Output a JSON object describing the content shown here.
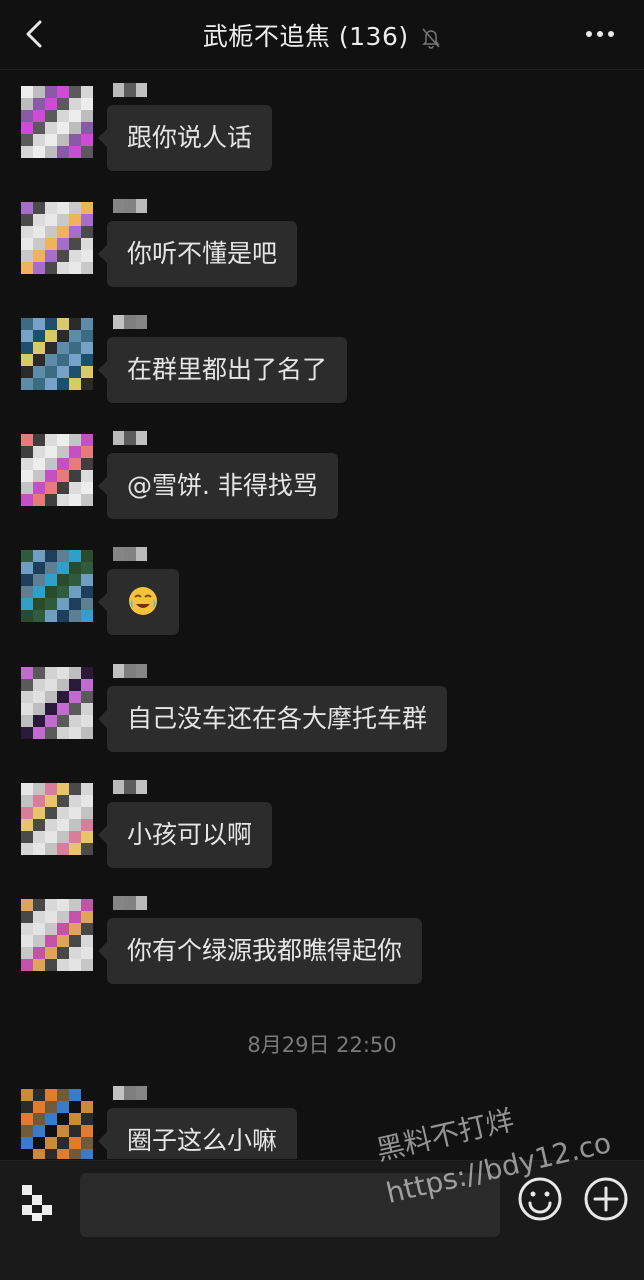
{
  "header": {
    "title": "武栀不追焦",
    "member_count": "(136)",
    "back_icon": "chevron-left-icon",
    "mute_icon": "bell-muted-icon",
    "more_icon": "more-dots-icon"
  },
  "messages": [
    {
      "text": "跟你说人话",
      "avatar_colors": [
        "#ededed",
        "#bdbdbd",
        "#8a5aa8",
        "#cf4ad6",
        "#5a5a5a",
        "#d6d6d6"
      ]
    },
    {
      "text": "你听不懂是吧",
      "avatar_colors": [
        "#e8e8e8",
        "#c9c9c9",
        "#f0b35a",
        "#a56fc9",
        "#4a4a4a",
        "#dcdcdc"
      ]
    },
    {
      "text": "在群里都出了名了",
      "avatar_colors": [
        "#3b6c84",
        "#77a2c7",
        "#1f4f6e",
        "#d9c96a",
        "#2a2a2a",
        "#5d8ca8"
      ]
    },
    {
      "text": "@雪饼. 非得找骂",
      "avatar_colors": [
        "#ededed",
        "#c5c5c5",
        "#c64fc4",
        "#e57b7b",
        "#3f3f3f",
        "#dcdcdc"
      ]
    },
    {
      "text": "",
      "emoji": "face-with-tears-of-joy-emoji",
      "avatar_colors": [
        "#2f5c3f",
        "#6f9ec2",
        "#1d3f5c",
        "#5e7f93",
        "#30a0c9",
        "#2c4a2c"
      ]
    },
    {
      "text": "自己没车还在各大摩托车群",
      "avatar_colors": [
        "#e0e0e0",
        "#bdbdbd",
        "#2a1a3a",
        "#c36ad0",
        "#5a5a5a",
        "#d2d2d2"
      ]
    },
    {
      "text": "小孩可以啊",
      "avatar_colors": [
        "#e6e6e6",
        "#c2c2c2",
        "#d97e9a",
        "#e8c46a",
        "#4a4a4a",
        "#d6d6d6"
      ]
    },
    {
      "text": "你有个绿源我都瞧得起你",
      "avatar_colors": [
        "#e4e4e4",
        "#c7c7c7",
        "#c651a8",
        "#e0a35a",
        "#474747",
        "#d8d8d8"
      ]
    },
    {
      "text": "圈子这么小嘛",
      "avatar_colors": [
        "#c98a3a",
        "#2b2b2b",
        "#e07b2f",
        "#6f5a3a",
        "#3a7ac9",
        "#111111"
      ]
    }
  ],
  "timestamp": "8月29日 22:50",
  "inputbar": {
    "voice_icon": "voice-keyboard-icon",
    "input_value": "",
    "emoji_icon": "smiley-icon",
    "plus_icon": "plus-circle-icon"
  },
  "watermark": {
    "line1": "黑料不打烊",
    "line2": "https://bdy12.co"
  },
  "colors": {
    "background": "#111111",
    "bubble": "#2c2c2c",
    "text": "#e5e5e5",
    "timestamp": "#7a7a7a"
  }
}
